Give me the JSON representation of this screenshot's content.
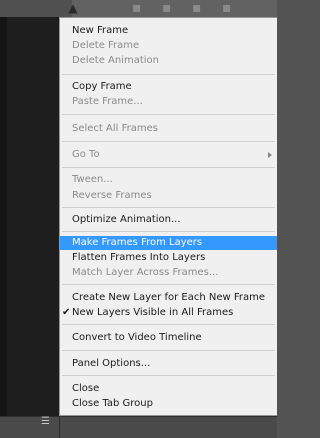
{
  "menu": {
    "items": [
      {
        "label": "New Frame"
      },
      {
        "label": "Delete Frame"
      },
      {
        "label": "Delete Animation"
      },
      {
        "label": "Copy Frame"
      },
      {
        "label": "Paste Frame..."
      },
      {
        "label": "Select All Frames"
      },
      {
        "label": "Go To"
      },
      {
        "label": "Tween..."
      },
      {
        "label": "Reverse Frames"
      },
      {
        "label": "Optimize Animation..."
      },
      {
        "label": "Make Frames From Layers"
      },
      {
        "label": "Flatten Frames Into Layers"
      },
      {
        "label": "Match Layer Across Frames..."
      },
      {
        "label": "Create New Layer for Each New Frame"
      },
      {
        "label": "New Layers Visible in All Frames"
      },
      {
        "label": "Convert to Video Timeline"
      },
      {
        "label": "Panel Options..."
      },
      {
        "label": "Close"
      },
      {
        "label": "Close Tab Group"
      }
    ],
    "check_mark": "✔"
  },
  "icons": {
    "top_icon": "arrange-icon",
    "bottom_icon": "panel-menu-icon"
  }
}
